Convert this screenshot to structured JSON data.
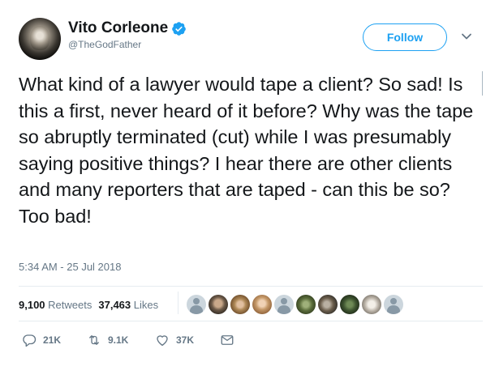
{
  "author": {
    "display_name": "Vito Corleone",
    "handle": "@TheGodFather",
    "verified": true
  },
  "follow_button": {
    "label": "Follow"
  },
  "tweet": {
    "text": "What kind of a lawyer would tape a client? So sad! Is this a first, never heard of it before? Why was the tape so abruptly terminated (cut) while I was presumably saying positive things? I hear there are other clients and many reporters that are taped - can this be so? Too bad!",
    "timestamp": "5:34 AM - 25 Jul 2018"
  },
  "stats": {
    "retweets_count": "9,100",
    "retweets_label": "Retweets",
    "likes_count": "37,463",
    "likes_label": "Likes"
  },
  "actions": {
    "reply_count": "21K",
    "retweet_count": "9.1K",
    "like_count": "37K"
  },
  "icons": {
    "verified": "verified-badge-icon",
    "chevron": "chevron-down-icon",
    "reply": "reply-icon",
    "retweet": "retweet-icon",
    "like": "heart-icon",
    "message": "direct-message-icon"
  },
  "colors": {
    "accent": "#1da1f2",
    "text": "#14171a",
    "secondary": "#657786"
  }
}
